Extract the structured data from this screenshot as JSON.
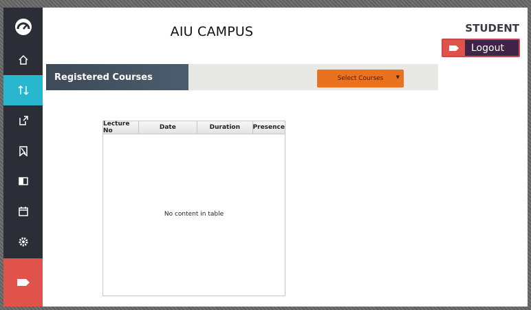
{
  "header": {
    "title": "AIU CAMPUS",
    "role": "STUDENT",
    "logout_label": "Logout"
  },
  "sidebar": {
    "items": [
      {
        "icon": "dashboard-gauge-icon",
        "active": false
      },
      {
        "icon": "home-icon",
        "active": false
      },
      {
        "icon": "sort-arrows-icon",
        "active": true
      },
      {
        "icon": "export-icon",
        "active": false
      },
      {
        "icon": "bookmark-icon",
        "active": false
      },
      {
        "icon": "panel-icon",
        "active": false
      },
      {
        "icon": "calendar-icon",
        "active": false
      },
      {
        "icon": "settings-gear-icon",
        "active": false
      },
      {
        "icon": "tag-icon",
        "active": false
      }
    ]
  },
  "courses": {
    "title": "Registered Courses",
    "select_label": "Select Courses"
  },
  "table": {
    "columns": [
      "Lecture No",
      "Date",
      "Duration",
      "Presence"
    ],
    "rows": [],
    "empty_message": "No content in table"
  },
  "colors": {
    "sidebar_bg": "#2b2e37",
    "active_item": "#29b6cf",
    "exit_item": "#e0534a",
    "select_button": "#e8721f",
    "logout_bg": "#3f2447"
  }
}
